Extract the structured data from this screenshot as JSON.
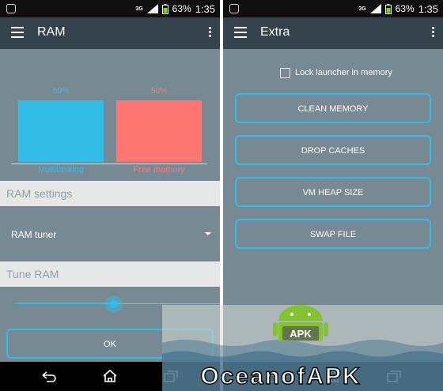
{
  "status_bar": {
    "network": "3G",
    "battery_pct": "63%",
    "time": "1:35"
  },
  "left": {
    "title": "RAM",
    "chart_data": {
      "type": "bar",
      "categories": [
        "Multitasking",
        "Free memory"
      ],
      "values": [
        50,
        50
      ],
      "value_labels": [
        "50%",
        "50%"
      ],
      "colors": [
        "#33bde6",
        "#fe7671"
      ]
    },
    "settings_header": "RAM settings",
    "spinner_label": "RAM tuner",
    "tune_header": "Tune RAM",
    "slider_value": 0.48,
    "ok_label": "OK"
  },
  "right": {
    "title": "Extra",
    "lock_label": "Lock launcher in memory",
    "lock_checked": false,
    "buttons": [
      "CLEAN MEMORY",
      "DROP CACHES",
      "VM HEAP SIZE",
      "SWAP FILE"
    ]
  },
  "watermark": {
    "brand": "OceanofAPK",
    "badge": "APK"
  },
  "colors": {
    "accent": "#33bde6",
    "salmon": "#fe7671",
    "panel": "#778a94",
    "app_bar": "#34434c"
  }
}
